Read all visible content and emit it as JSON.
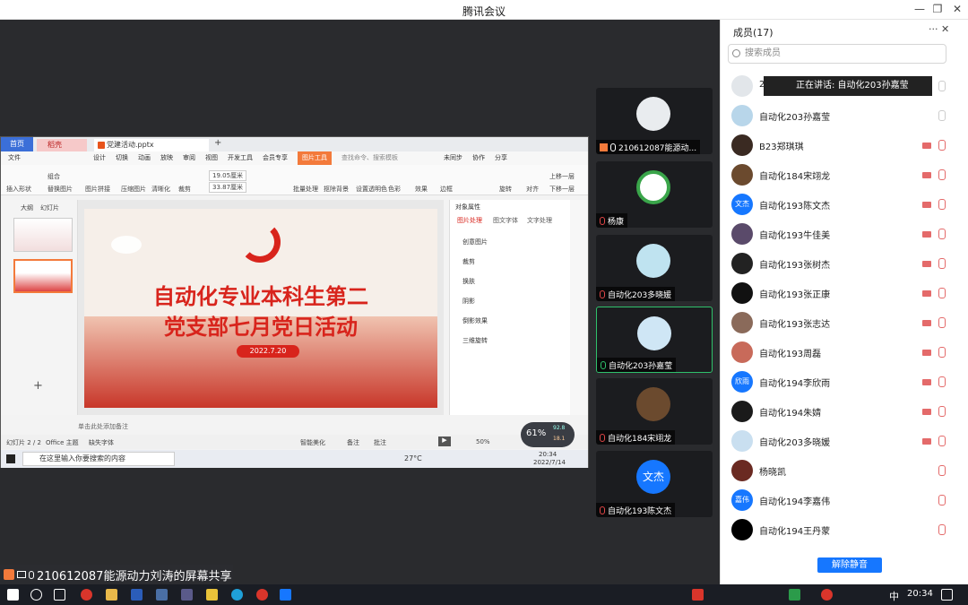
{
  "window": {
    "title": "腾讯会议"
  },
  "share_label": "210612087能源动力刘涛的屏幕共享",
  "ppt": {
    "tabs": [
      "首页",
      "稻壳",
      "党建活动.pptx"
    ],
    "menu": [
      "文件",
      "开始",
      "插入",
      "设计",
      "切换",
      "动画",
      "放映",
      "审阅",
      "视图",
      "开发工具",
      "会员专享",
      "图片工具"
    ],
    "search": "查找命令、搜索模板",
    "cloud": [
      "未同步",
      "协作",
      "分享"
    ],
    "ribbon": [
      "插入形状",
      "组合",
      "替换图片",
      "图片拼接",
      "压缩图片",
      "清晰化",
      "裁剪",
      "批量处理",
      "抠除背景",
      "设置透明色",
      "色彩",
      "效果",
      "边框",
      "旋转",
      "对齐",
      "上移一层",
      "下移一层"
    ],
    "size": [
      "19.05厘米",
      "33.87厘米"
    ],
    "side_tabs": [
      "大纲",
      "幻灯片"
    ],
    "slide_title_1": "自动化专业本科生第二",
    "slide_title_2": "党支部七月党日活动",
    "slide_date": "2022.7.20",
    "notes": "单击此处添加备注",
    "status": [
      "幻灯片 2 / 2",
      "Office 主题",
      "缺失字体"
    ],
    "status_right": [
      "智能美化",
      "备注",
      "批注",
      "50%"
    ],
    "props_title": "对象属性",
    "props_tabs": [
      "图片处理",
      "图文字体",
      "文字处理"
    ],
    "props_items": [
      "创意图片",
      "裁剪",
      "换肤",
      "阴影",
      "倒影效果",
      "三维旋转"
    ],
    "win_search": "在这里输入你要搜索的内容",
    "win_temp": "27°C",
    "win_time": "20:34",
    "win_date": "2022/7/14",
    "meter": "61%",
    "meter_up": "92.8",
    "meter_down": "18.1"
  },
  "video_tiles": [
    {
      "name": "210612087能源动..."
    },
    {
      "name": "杨康"
    },
    {
      "name": "自动化203多晓媛"
    },
    {
      "name": "自动化203孙嘉莹"
    },
    {
      "name": "自动化184宋翊龙"
    },
    {
      "name": "自动化193陈文杰",
      "avatar_text": "文杰"
    }
  ],
  "panel": {
    "title": "成员(17)",
    "search_placeholder": "搜索成员",
    "speaking": "正在讲话: 自动化203孙嘉莹",
    "members": [
      {
        "name": "2..."
      },
      {
        "name": "自动化203孙嘉莹"
      },
      {
        "name": "B23郑琪琪"
      },
      {
        "name": "自动化184宋翊龙"
      },
      {
        "name": "自动化193陈文杰",
        "avatar_text": "文杰"
      },
      {
        "name": "自动化193牛佳美"
      },
      {
        "name": "自动化193张树杰"
      },
      {
        "name": "自动化193张正康"
      },
      {
        "name": "自动化193张志达"
      },
      {
        "name": "自动化193周磊"
      },
      {
        "name": "自动化194李欣雨",
        "avatar_text": "欣雨"
      },
      {
        "name": "自动化194朱婧"
      },
      {
        "name": "自动化203多晓媛"
      },
      {
        "name": "杨晓凯"
      },
      {
        "name": "自动化194李嘉伟",
        "avatar_text": "嘉伟"
      },
      {
        "name": "自动化194王丹蒙"
      }
    ],
    "unmute": "解除静音"
  },
  "taskbar": {
    "time": "20:34",
    "ime": "中"
  },
  "colors": {
    "accent": "#1677ff",
    "party_red": "#d8241c",
    "talk_green": "#2fc16b"
  }
}
